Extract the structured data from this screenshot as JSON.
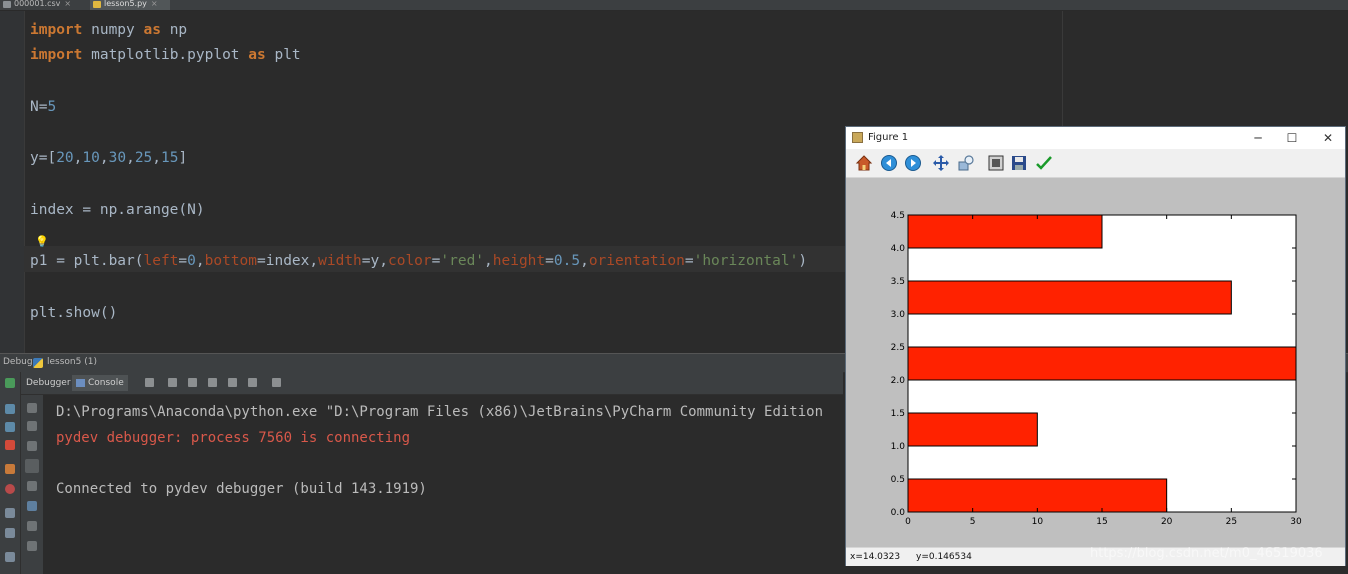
{
  "tabs": [
    {
      "label": "000001.csv"
    },
    {
      "label": "lesson5.py"
    }
  ],
  "debug_bar": {
    "title": "Debug",
    "config": "lesson5 (1)"
  },
  "debug_tabs": {
    "debugger": "Debugger",
    "console": "Console"
  },
  "console_lines": [
    "D:\\Programs\\Anaconda\\python.exe \"D:\\Program Files (x86)\\JetBrains\\PyCharm Community Edition",
    "pydev debugger: process 7560 is connecting",
    "Connected to pydev debugger (build 143.1919)"
  ],
  "figure": {
    "title": "Figure 1",
    "status_x": "x=14.0323",
    "status_y": "y=0.146534"
  },
  "colors": {
    "bar": "#ff2200",
    "keyword": "#cc7832",
    "number": "#6897bb",
    "string": "#6a8759",
    "param": "#aa4926"
  },
  "chart_data": {
    "type": "bar",
    "orientation": "horizontal",
    "y": [
      0,
      1,
      2,
      3,
      4
    ],
    "values": [
      20,
      10,
      30,
      25,
      15
    ],
    "bar_height": 0.5,
    "xlim": [
      0,
      30
    ],
    "ylim": [
      0,
      4.5
    ],
    "xticks": [
      "0",
      "5",
      "10",
      "15",
      "20",
      "25",
      "30"
    ],
    "yticks": [
      "0.0",
      "0.5",
      "1.0",
      "1.5",
      "2.0",
      "2.5",
      "3.0",
      "3.5",
      "4.0",
      "4.5"
    ],
    "color": "#ff2200"
  },
  "watermark": "https://blog.csdn.net/m0_46519036"
}
